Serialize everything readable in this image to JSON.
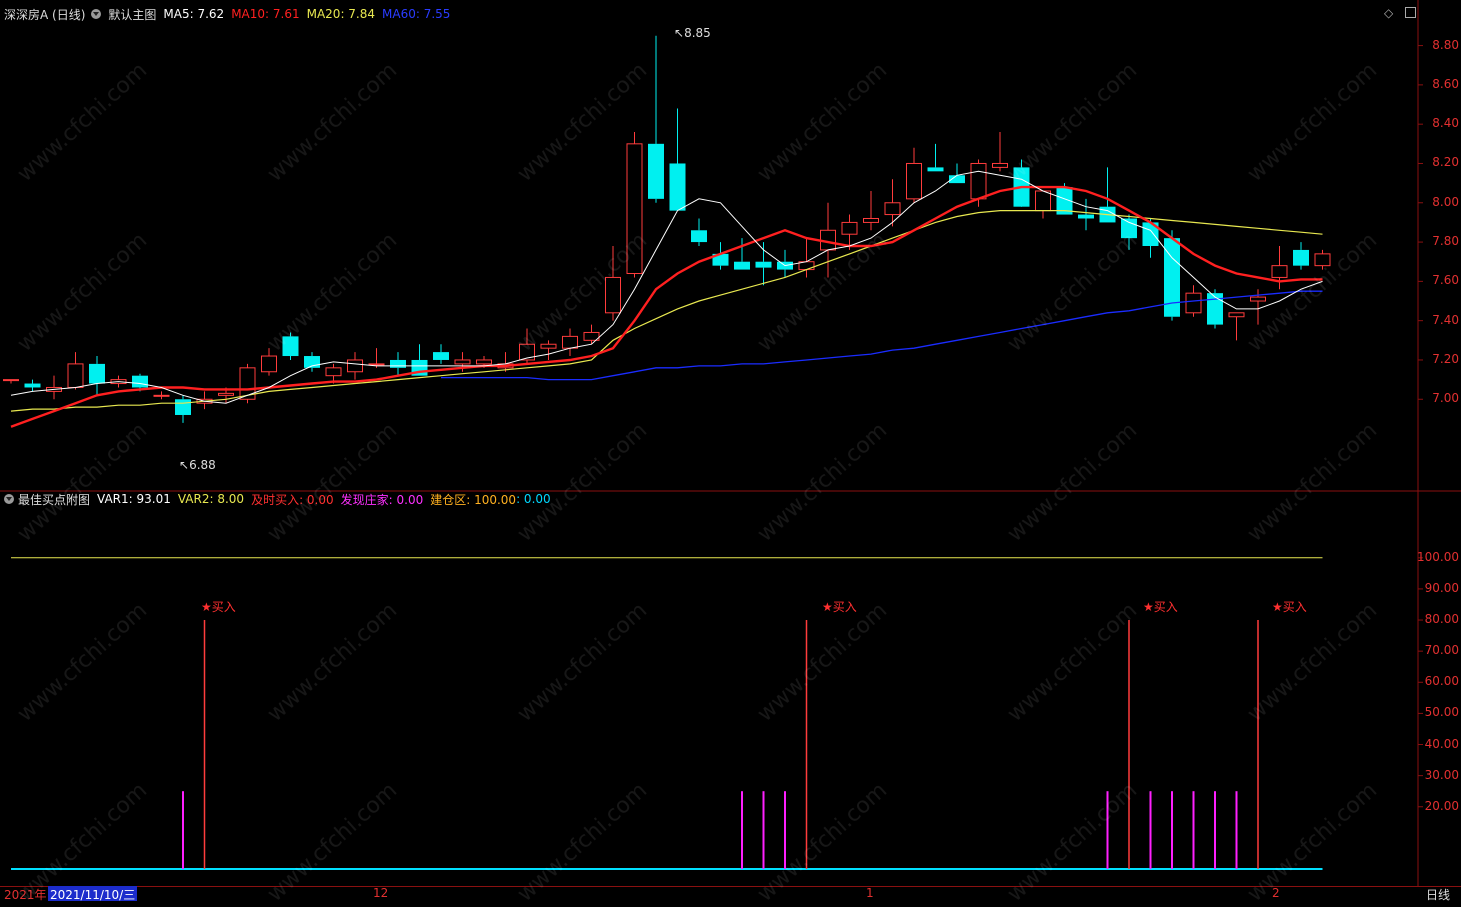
{
  "main_header": {
    "stock": "深深房A (日线)",
    "indicator": "默认主图",
    "ma5": "MA5: 7.62",
    "ma10": "MA10: 7.61",
    "ma20": "MA20: 7.84",
    "ma60": "MA60: 7.55"
  },
  "sub_header": {
    "indicator": "最佳买点附图",
    "var1": "VAR1: 93.01",
    "var2": "VAR2: 8.00",
    "buy": "及时买入: 0.00",
    "dealer": "发现庄家: 0.00",
    "zone": "建仓区: 100.00",
    "last": ": 0.00"
  },
  "price_axis": [
    "8.80",
    "8.60",
    "8.40",
    "8.20",
    "8.00",
    "7.80",
    "7.60",
    "7.40",
    "7.20",
    "7.00"
  ],
  "sub_axis": [
    "100.00",
    "90.00",
    "80.00",
    "70.00",
    "60.00",
    "50.00",
    "40.00",
    "30.00",
    "20.00"
  ],
  "annotations": {
    "high": "8.85",
    "low": "6.88"
  },
  "buy_label": "★买入",
  "date_bar": {
    "year": "2021年",
    "cursor_date": "2021/11/10/三",
    "m12": "12",
    "m1": "1",
    "m2": "2",
    "period": "日线"
  },
  "watermark": "www.cfchi.com",
  "colors": {
    "up": "#ff3c3c",
    "down": "#00f0f0",
    "ma5": "#ffffff",
    "ma10": "#ff2020",
    "ma20": "#e8e850",
    "ma60": "#1a2cff",
    "var2": "#e8e850",
    "dealer": "#ff20ff",
    "zone_line": "#00e0ff"
  },
  "chart_data": {
    "type": "candlestick",
    "price_range": [
      6.7,
      8.9
    ],
    "candles": [
      [
        7.1,
        7.1,
        7.08,
        7.1
      ],
      [
        7.08,
        7.1,
        7.04,
        7.06
      ],
      [
        7.04,
        7.12,
        7.0,
        7.06
      ],
      [
        7.06,
        7.24,
        7.05,
        7.18
      ],
      [
        7.18,
        7.22,
        7.02,
        7.08
      ],
      [
        7.08,
        7.12,
        7.06,
        7.1
      ],
      [
        7.12,
        7.13,
        7.04,
        7.06
      ],
      [
        7.02,
        7.04,
        7.0,
        7.02
      ],
      [
        7.0,
        7.02,
        6.88,
        6.92
      ],
      [
        6.98,
        7.04,
        6.95,
        7.0
      ],
      [
        7.02,
        7.06,
        6.98,
        7.03
      ],
      [
        7.0,
        7.18,
        6.98,
        7.16
      ],
      [
        7.14,
        7.26,
        7.12,
        7.22
      ],
      [
        7.32,
        7.34,
        7.2,
        7.22
      ],
      [
        7.22,
        7.24,
        7.14,
        7.16
      ],
      [
        7.12,
        7.18,
        7.08,
        7.16
      ],
      [
        7.14,
        7.24,
        7.1,
        7.2
      ],
      [
        7.18,
        7.26,
        7.16,
        7.18
      ],
      [
        7.2,
        7.24,
        7.12,
        7.16
      ],
      [
        7.2,
        7.28,
        7.12,
        7.12
      ],
      [
        7.24,
        7.28,
        7.18,
        7.2
      ],
      [
        7.18,
        7.24,
        7.14,
        7.2
      ],
      [
        7.18,
        7.22,
        7.16,
        7.2
      ],
      [
        7.16,
        7.24,
        7.14,
        7.18
      ],
      [
        7.2,
        7.36,
        7.18,
        7.28
      ],
      [
        7.26,
        7.3,
        7.2,
        7.28
      ],
      [
        7.26,
        7.36,
        7.22,
        7.32
      ],
      [
        7.3,
        7.38,
        7.28,
        7.34
      ],
      [
        7.44,
        7.78,
        7.4,
        7.62
      ],
      [
        7.64,
        8.36,
        7.62,
        8.3
      ],
      [
        8.3,
        8.85,
        8.0,
        8.02
      ],
      [
        8.2,
        8.48,
        7.98,
        7.96
      ],
      [
        7.86,
        7.92,
        7.78,
        7.8
      ],
      [
        7.74,
        7.8,
        7.66,
        7.68
      ],
      [
        7.7,
        7.82,
        7.66,
        7.66
      ],
      [
        7.7,
        7.8,
        7.58,
        7.67
      ],
      [
        7.7,
        7.76,
        7.62,
        7.66
      ],
      [
        7.66,
        7.82,
        7.62,
        7.7
      ],
      [
        7.76,
        8.0,
        7.62,
        7.86
      ],
      [
        7.84,
        7.94,
        7.76,
        7.9
      ],
      [
        7.9,
        8.06,
        7.86,
        7.92
      ],
      [
        7.94,
        8.12,
        7.88,
        8.0
      ],
      [
        8.02,
        8.28,
        8.0,
        8.2
      ],
      [
        8.18,
        8.3,
        8.16,
        8.16
      ],
      [
        8.14,
        8.2,
        8.1,
        8.1
      ],
      [
        8.02,
        8.22,
        7.98,
        8.2
      ],
      [
        8.18,
        8.36,
        8.16,
        8.2
      ],
      [
        8.18,
        8.22,
        8.06,
        7.98
      ],
      [
        7.96,
        8.06,
        7.92,
        8.06
      ],
      [
        8.08,
        8.1,
        7.94,
        7.94
      ],
      [
        7.94,
        8.02,
        7.86,
        7.92
      ],
      [
        7.98,
        8.18,
        7.9,
        7.9
      ],
      [
        7.92,
        7.94,
        7.76,
        7.82
      ],
      [
        7.9,
        7.92,
        7.72,
        7.78
      ],
      [
        7.82,
        7.86,
        7.4,
        7.42
      ],
      [
        7.44,
        7.58,
        7.42,
        7.54
      ],
      [
        7.54,
        7.56,
        7.36,
        7.38
      ],
      [
        7.42,
        7.44,
        7.3,
        7.44
      ],
      [
        7.5,
        7.56,
        7.38,
        7.52
      ],
      [
        7.62,
        7.78,
        7.56,
        7.68
      ],
      [
        7.76,
        7.8,
        7.66,
        7.68
      ],
      [
        7.68,
        7.76,
        7.66,
        7.74
      ]
    ],
    "ma5": [
      7.02,
      7.04,
      7.05,
      7.06,
      7.08,
      7.09,
      7.08,
      7.06,
      7.02,
      6.99,
      6.98,
      7.02,
      7.06,
      7.12,
      7.17,
      7.19,
      7.18,
      7.17,
      7.17,
      7.17,
      7.17,
      7.17,
      7.17,
      7.18,
      7.21,
      7.23,
      7.26,
      7.28,
      7.38,
      7.56,
      7.76,
      7.96,
      8.02,
      8.0,
      7.88,
      7.76,
      7.68,
      7.7,
      7.76,
      7.78,
      7.82,
      7.9,
      8.0,
      8.06,
      8.14,
      8.16,
      8.14,
      8.12,
      8.06,
      8.02,
      7.98,
      7.96,
      7.9,
      7.86,
      7.72,
      7.62,
      7.52,
      7.46,
      7.46,
      7.5,
      7.56,
      7.6
    ],
    "ma10": [
      6.86,
      6.9,
      6.94,
      6.98,
      7.02,
      7.04,
      7.05,
      7.06,
      7.06,
      7.05,
      7.05,
      7.05,
      7.06,
      7.07,
      7.08,
      7.09,
      7.09,
      7.1,
      7.12,
      7.14,
      7.15,
      7.16,
      7.17,
      7.17,
      7.18,
      7.19,
      7.2,
      7.22,
      7.26,
      7.4,
      7.56,
      7.64,
      7.7,
      7.74,
      7.78,
      7.82,
      7.86,
      7.82,
      7.8,
      7.78,
      7.78,
      7.8,
      7.86,
      7.92,
      7.98,
      8.02,
      8.06,
      8.08,
      8.08,
      8.08,
      8.06,
      8.02,
      7.96,
      7.9,
      7.82,
      7.74,
      7.68,
      7.64,
      7.62,
      7.6,
      7.61,
      7.61
    ],
    "ma20": [
      6.94,
      6.95,
      6.95,
      6.96,
      6.96,
      6.97,
      6.97,
      6.98,
      6.98,
      6.99,
      7.0,
      7.02,
      7.04,
      7.05,
      7.06,
      7.07,
      7.08,
      7.09,
      7.1,
      7.11,
      7.12,
      7.13,
      7.14,
      7.15,
      7.16,
      7.17,
      7.18,
      7.2,
      7.3,
      7.36,
      7.41,
      7.46,
      7.5,
      7.53,
      7.56,
      7.59,
      7.62,
      7.66,
      7.7,
      7.74,
      7.78,
      7.82,
      7.86,
      7.9,
      7.93,
      7.95,
      7.96,
      7.96,
      7.96,
      7.96,
      7.95,
      7.94,
      7.93,
      7.92,
      7.91,
      7.9,
      7.89,
      7.88,
      7.87,
      7.86,
      7.85,
      7.84
    ],
    "ma60_start_index": 20,
    "ma60": [
      7.11,
      7.11,
      7.11,
      7.11,
      7.11,
      7.1,
      7.1,
      7.1,
      7.12,
      7.14,
      7.16,
      7.16,
      7.17,
      7.17,
      7.18,
      7.18,
      7.19,
      7.2,
      7.21,
      7.22,
      7.23,
      7.25,
      7.26,
      7.28,
      7.3,
      7.32,
      7.34,
      7.36,
      7.38,
      7.4,
      7.42,
      7.44,
      7.45,
      7.47,
      7.49,
      7.5,
      7.51,
      7.52,
      7.53,
      7.54,
      7.55,
      7.55
    ],
    "sub_range": [
      0,
      110
    ],
    "var2_level": 100,
    "buy_signals": [
      {
        "index": 9,
        "value": 80
      },
      {
        "index": 37,
        "value": 80
      },
      {
        "index": 52,
        "value": 80
      },
      {
        "index": 58,
        "value": 80
      }
    ],
    "dealer_signals": [
      {
        "index": 8,
        "value": 25
      },
      {
        "index": 34,
        "value": 25
      },
      {
        "index": 35,
        "value": 25
      },
      {
        "index": 36,
        "value": 25
      },
      {
        "index": 51,
        "value": 25
      },
      {
        "index": 53,
        "value": 25
      },
      {
        "index": 54,
        "value": 25
      },
      {
        "index": 55,
        "value": 25
      },
      {
        "index": 56,
        "value": 25
      },
      {
        "index": 57,
        "value": 25
      }
    ]
  }
}
